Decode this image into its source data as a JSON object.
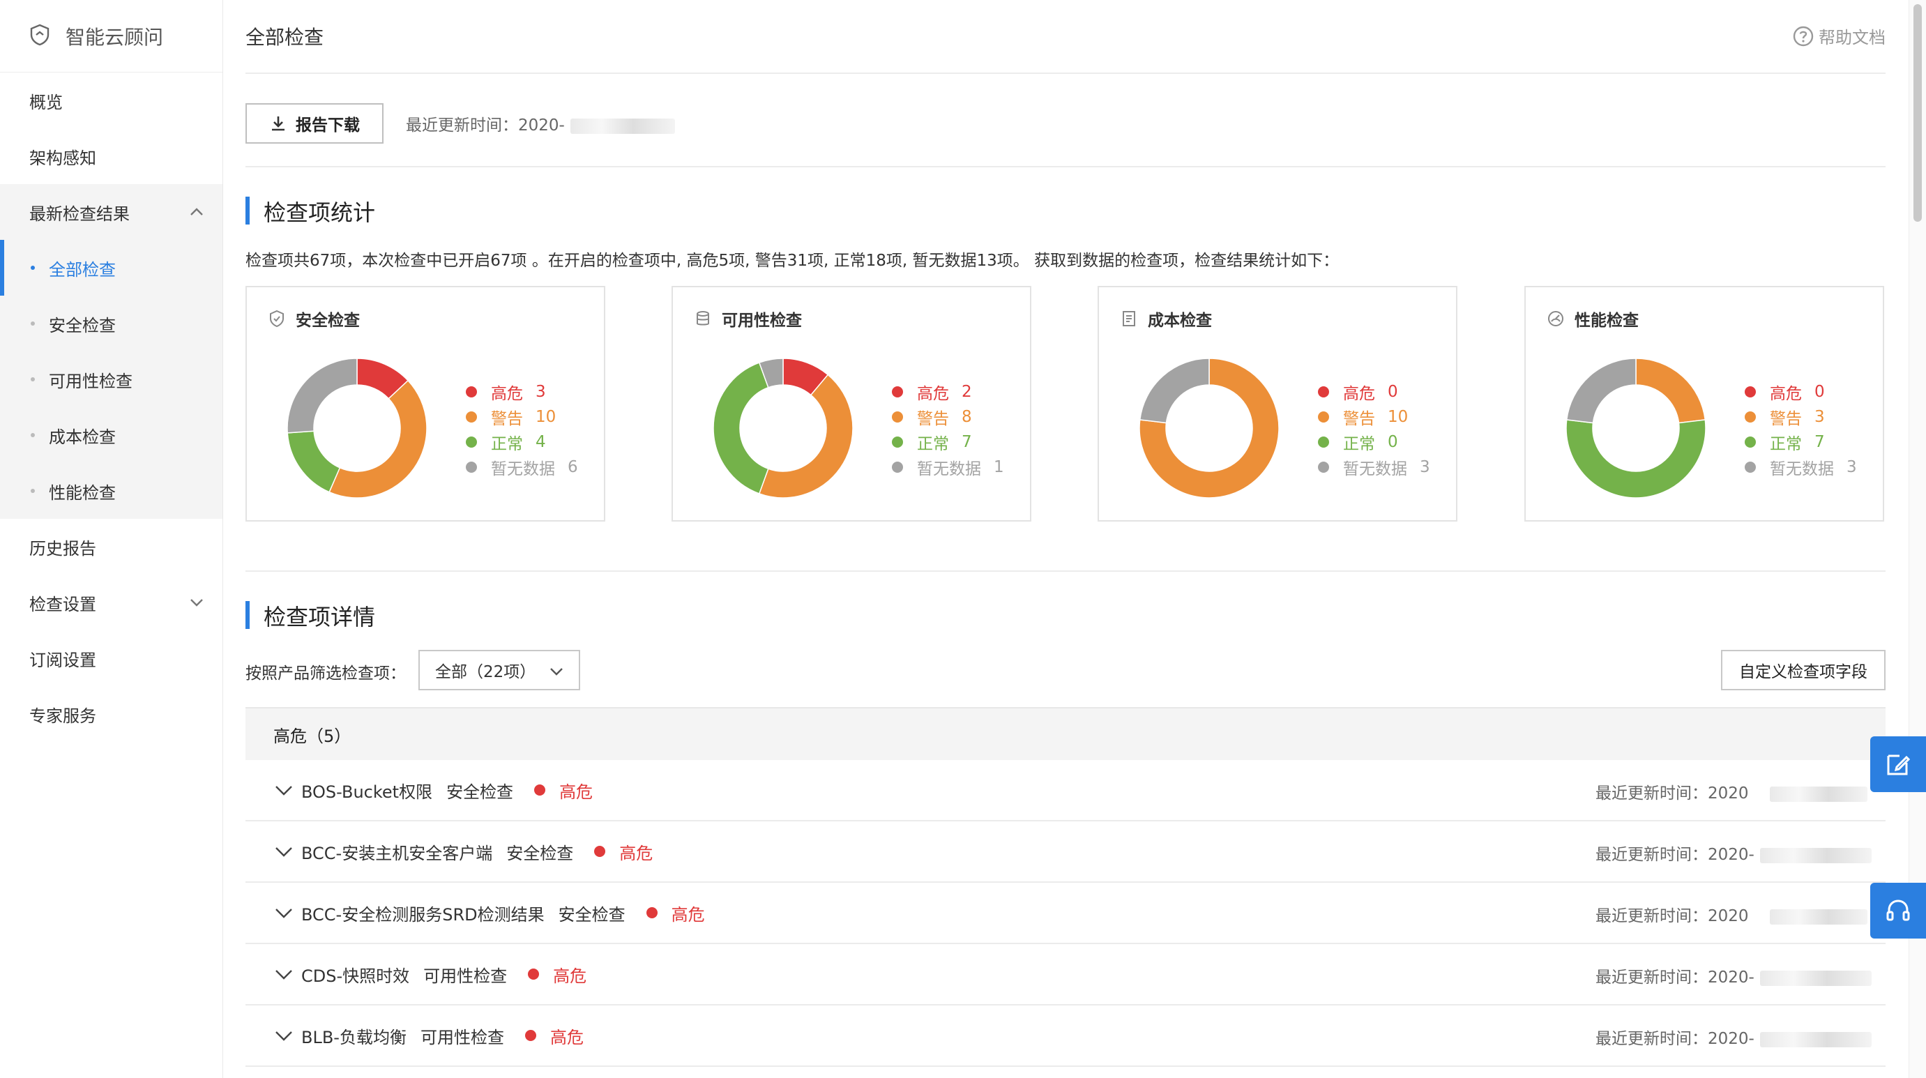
{
  "sidebar": {
    "brand": "智能云顾问",
    "items": [
      {
        "label": "概览"
      },
      {
        "label": "架构感知"
      },
      {
        "label": "最新检查结果"
      },
      {
        "label": "历史报告"
      },
      {
        "label": "检查设置"
      },
      {
        "label": "订阅设置"
      },
      {
        "label": "专家服务"
      }
    ],
    "subitems": [
      {
        "label": "全部检查",
        "active": true
      },
      {
        "label": "安全检查"
      },
      {
        "label": "可用性检查"
      },
      {
        "label": "成本检查"
      },
      {
        "label": "性能检查"
      }
    ]
  },
  "header": {
    "title": "全部检查",
    "help": "帮助文档"
  },
  "toolbar": {
    "download": "报告下载",
    "updated_prefix": "最近更新时间：2020-"
  },
  "stats": {
    "title": "检查项统计",
    "summary": "检查项共67项，本次检查中已开启67项 。在开启的检查项中, 高危5项, 警告31项, 正常18项, 暂无数据13项。 获取到数据的检查项，检查结果统计如下：",
    "legend_labels": {
      "high": "高危",
      "warn": "警告",
      "normal": "正常",
      "nodata": "暂无数据"
    },
    "colors": {
      "high": "#e03a3a",
      "warn": "#ec8f38",
      "normal": "#74b24a",
      "nodata": "#a3a3a3",
      "accent": "#2b7fe0"
    },
    "cards": [
      {
        "title": "安全检查",
        "icon": "shield-icon",
        "values": {
          "high": "3",
          "warn": "10",
          "normal": "4",
          "nodata": "6"
        }
      },
      {
        "title": "可用性检查",
        "icon": "database-icon",
        "values": {
          "high": "2",
          "warn": "8",
          "normal": "7",
          "nodata": "1"
        }
      },
      {
        "title": "成本检查",
        "icon": "document-icon",
        "values": {
          "high": "0",
          "warn": "10",
          "normal": "0",
          "nodata": "3"
        }
      },
      {
        "title": "性能检查",
        "icon": "gauge-icon",
        "values": {
          "high": "0",
          "warn": "3",
          "normal": "7",
          "nodata": "3"
        }
      }
    ]
  },
  "details": {
    "title": "检查项详情",
    "filter_label": "按照产品筛选检查项：",
    "filter_value": "全部（22项）",
    "custom_button": "自定义检查项字段",
    "group_label": "高危（5）",
    "rows": [
      {
        "name": "BOS-Bucket权限",
        "category": "安全检查",
        "level": "高危",
        "updated": "最近更新时间：2020"
      },
      {
        "name": "BCC-安装主机安全客户端",
        "category": "安全检查",
        "level": "高危",
        "updated": "最近更新时间：2020-"
      },
      {
        "name": "BCC-安全检测服务SRD检测结果",
        "category": "安全检查",
        "level": "高危",
        "updated": "最近更新时间：2020"
      },
      {
        "name": "CDS-快照时效",
        "category": "可用性检查",
        "level": "高危",
        "updated": "最近更新时间：2020-"
      },
      {
        "name": "BLB-负载均衡",
        "category": "可用性检查",
        "level": "高危",
        "updated": "最近更新时间：2020-"
      }
    ]
  }
}
